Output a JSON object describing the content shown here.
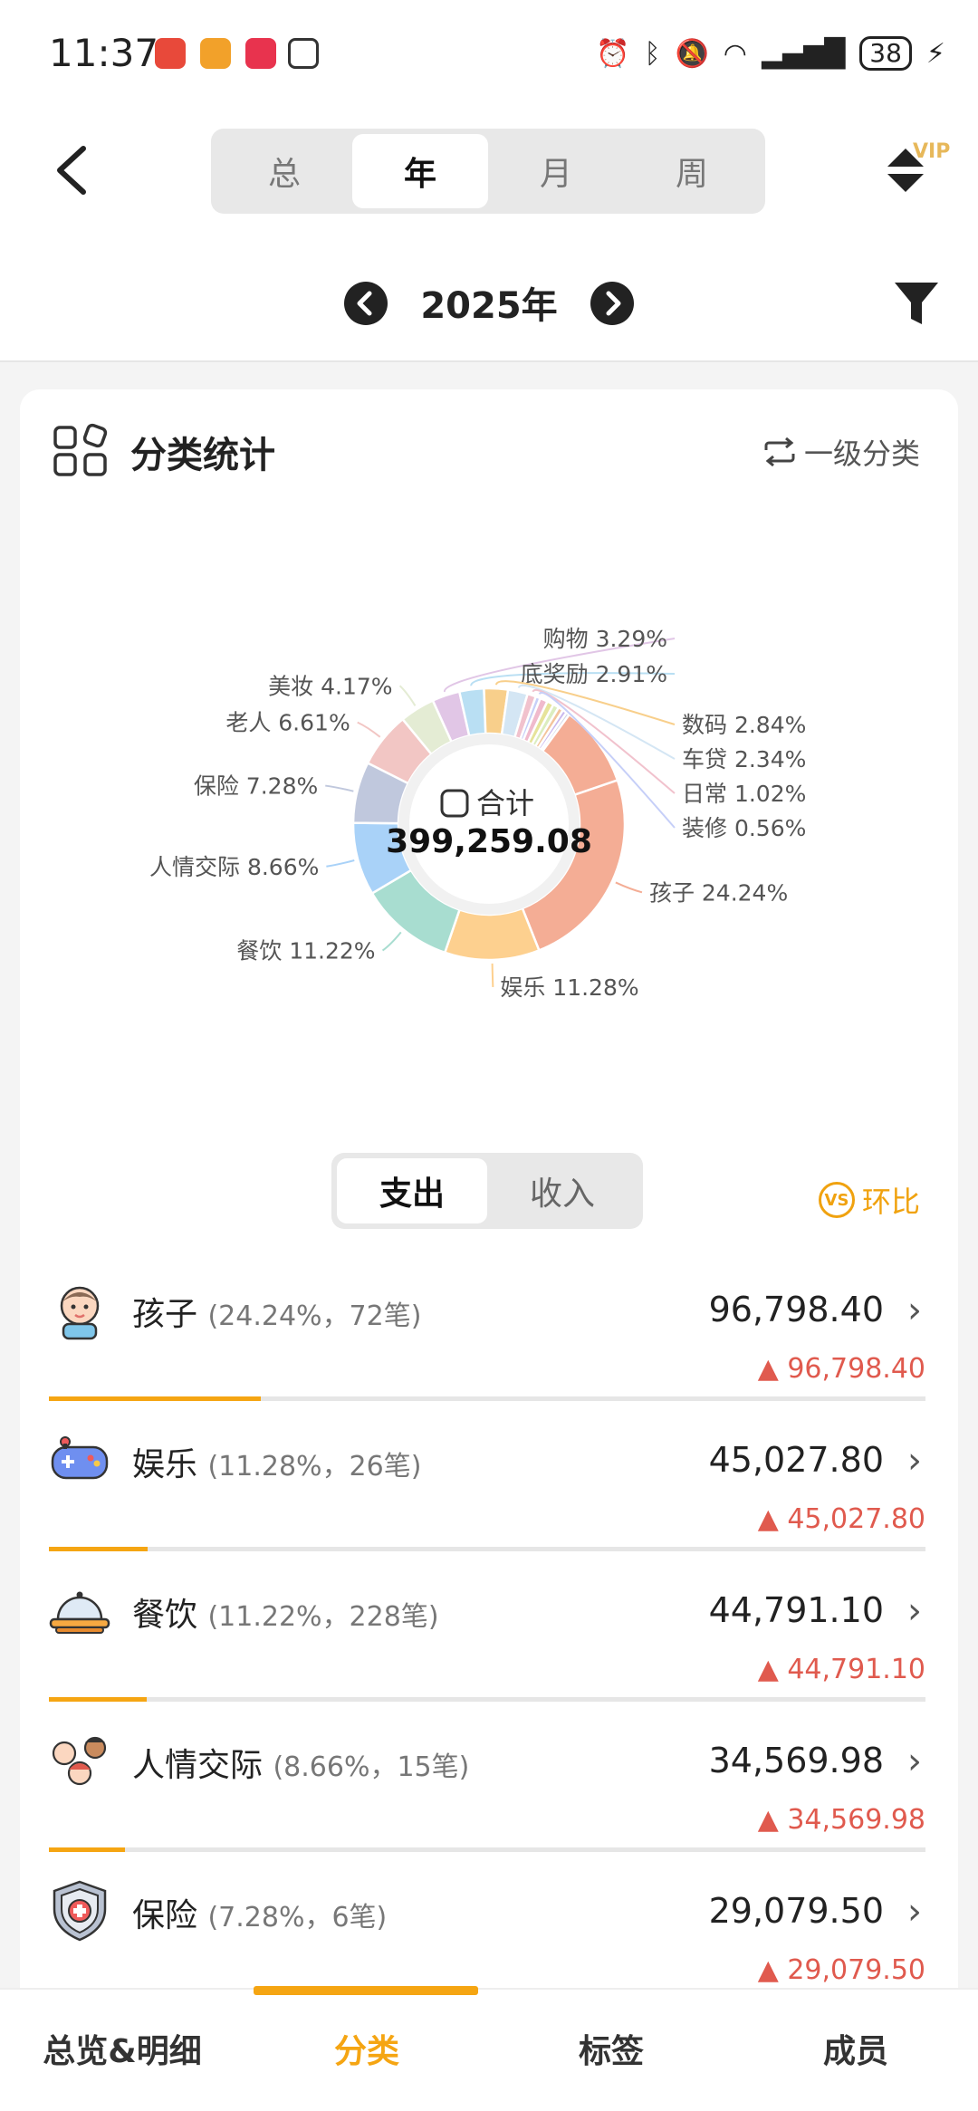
{
  "status_bar": {
    "time": "11:37",
    "battery": "38"
  },
  "header": {
    "tabs": [
      "总",
      "年",
      "月",
      "周"
    ],
    "active_tab": 1,
    "year": "2025年",
    "vip_badge": "VIP"
  },
  "card": {
    "title": "分类统计",
    "level_toggle_label": "一级分类",
    "total_label": "合计",
    "total_value": "399,259.08"
  },
  "chart_data": {
    "type": "pie",
    "donut": true,
    "categories": [
      "孩子",
      "娱乐",
      "餐饮",
      "人情交际",
      "保险",
      "老人",
      "美妆",
      "购物",
      "底奖励",
      "数码",
      "车贷",
      "日常",
      "装修"
    ],
    "values": [
      24.24,
      11.28,
      11.22,
      8.66,
      7.28,
      6.61,
      4.17,
      3.29,
      2.91,
      2.84,
      2.34,
      1.02,
      0.56
    ],
    "labels": [
      "孩子 24.24%",
      "娱乐 11.28%",
      "餐饮 11.22%",
      "人情交际 8.66%",
      "保险 7.28%",
      "老人 6.61%",
      "美妆 4.17%",
      "购物 3.29%",
      "底奖励 2.91%",
      "数码 2.84%",
      "车贷 2.34%",
      "日常 1.02%",
      "装修 0.56%"
    ],
    "colors": [
      "#f4ad95",
      "#fdd08f",
      "#a8ddd0",
      "#a9d2f8",
      "#c0c8dd",
      "#f2c6c4",
      "#e4ecd4",
      "#e1c6e6",
      "#b9dff3",
      "#f8cf8b",
      "#d4e6f4",
      "#f1c2cd",
      "#c6cff8",
      "#f0bacd",
      "#e6e39a",
      "#dcedbf",
      "#f3c49c",
      "#c9b8ee",
      "#d0d6e6"
    ]
  },
  "type_toggle": {
    "options": [
      "支出",
      "收入"
    ],
    "active": 0
  },
  "compare_label": "环比",
  "compare_icon_text": "VS",
  "rows": [
    {
      "name": "孩子",
      "meta": "(24.24%，72笔)",
      "amount": "96,798.40",
      "delta": "96,798.40",
      "percent": 24.24
    },
    {
      "name": "娱乐",
      "meta": "(11.28%，26笔)",
      "amount": "45,027.80",
      "delta": "45,027.80",
      "percent": 11.28
    },
    {
      "name": "餐饮",
      "meta": "(11.22%，228笔)",
      "amount": "44,791.10",
      "delta": "44,791.10",
      "percent": 11.22
    },
    {
      "name": "人情交际",
      "meta": "(8.66%，15笔)",
      "amount": "34,569.98",
      "delta": "34,569.98",
      "percent": 8.66
    },
    {
      "name": "保险",
      "meta": "(7.28%，6笔)",
      "amount": "29,079.50",
      "delta": "29,079.50",
      "percent": 7.28
    }
  ],
  "bottom_nav": {
    "items": [
      "总览&明细",
      "分类",
      "标签",
      "成员"
    ],
    "active": 1
  }
}
